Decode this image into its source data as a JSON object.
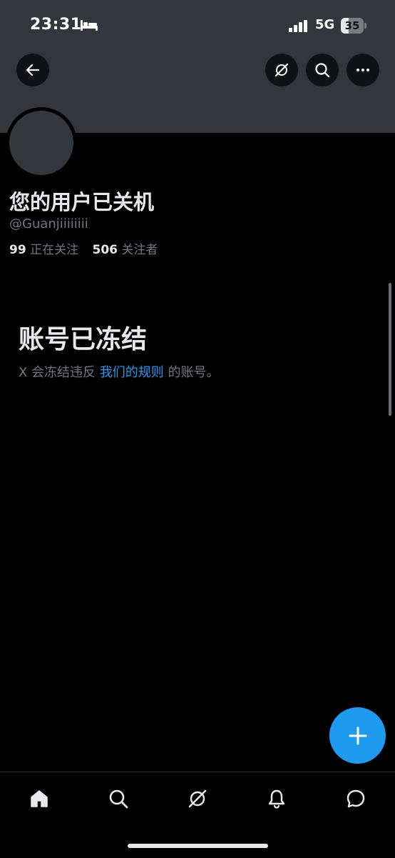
{
  "status_bar": {
    "time": "23:31",
    "network": "5G",
    "battery": "35",
    "battery_level_percent": 35,
    "icons": [
      "bed-icon",
      "signal-icon"
    ]
  },
  "header": {
    "icons": [
      "back-arrow-icon",
      "grok-icon",
      "search-icon",
      "more-icon"
    ]
  },
  "profile": {
    "display_name": "您的用户已关机",
    "handle": "@Guanjiiiiiiii",
    "following_count": "99",
    "following_label": "正在关注",
    "followers_count": "506",
    "followers_label": "关注者"
  },
  "frozen": {
    "title": "账号已冻结",
    "desc_prefix": "X 会冻结违反",
    "desc_link": "我们的规则",
    "desc_suffix": "的账号。"
  },
  "fab": {
    "icon": "plus-icon"
  },
  "tabbar": {
    "icons": [
      "home-icon",
      "search-icon",
      "grok-icon",
      "notifications-icon",
      "messages-icon"
    ]
  },
  "colors": {
    "banner": "#33363a",
    "accent": "#1d9bf0",
    "secondary_text": "#71767b",
    "primary_text": "#e7e9ea"
  }
}
